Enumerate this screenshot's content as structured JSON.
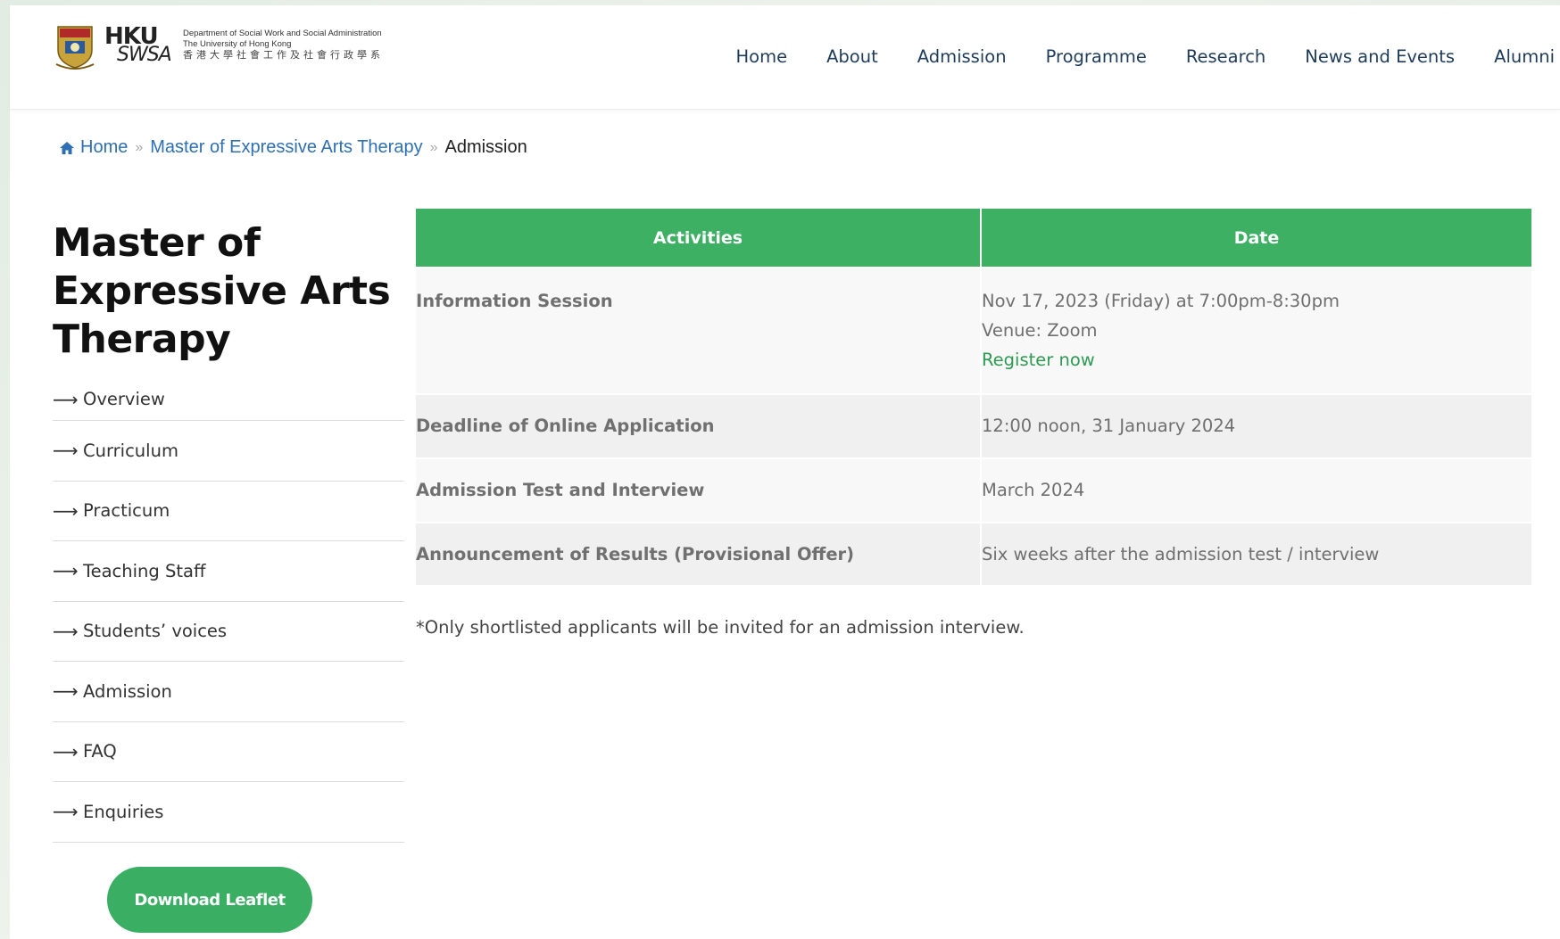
{
  "header": {
    "logo": {
      "mark_hku": "HKU",
      "mark_swsa": "SWSA",
      "dept_line1": "Department of Social Work and Social Administration",
      "dept_line2": "The University of Hong Kong",
      "dept_line3": "香港大學社會工作及社會行政學系"
    },
    "nav": [
      "Home",
      "About",
      "Admission",
      "Programme",
      "Research",
      "News and Events",
      "Alumni"
    ]
  },
  "breadcrumb": {
    "home": "Home",
    "parent": "Master of Expressive Arts Therapy",
    "current": "Admission",
    "separator": "»",
    "icon": "home-icon"
  },
  "sidebar": {
    "title": "Master of Expressive Arts Therapy",
    "arrow": "⟶",
    "items": [
      "Overview",
      "Curriculum",
      "Practicum",
      "Teaching Staff",
      "Students’ voices",
      "Admission",
      "FAQ",
      "Enquiries"
    ],
    "download_label": "Download Leaflet"
  },
  "table": {
    "headers": [
      "Activities",
      "Date"
    ],
    "rows": [
      {
        "activity": "Information Session",
        "date": "Nov 17, 2023 (Friday) at 7:00pm-8:30pm",
        "venue": "Venue: Zoom",
        "link": "Register now"
      },
      {
        "activity": "Deadline of Online Application",
        "date": "12:00 noon, 31 January 2024"
      },
      {
        "activity": "Admission Test and Interview",
        "date": "March 2024"
      },
      {
        "activity": "Announcement of Results (Provisional Offer)",
        "date": "Six weeks after the admission test / interview"
      }
    ]
  },
  "footnote": "*Only shortlisted applicants will be invited for an admission interview.",
  "colors": {
    "accent_green": "#3db063",
    "link_blue": "#2f6fb3",
    "nav_text": "#1f3b5a"
  }
}
